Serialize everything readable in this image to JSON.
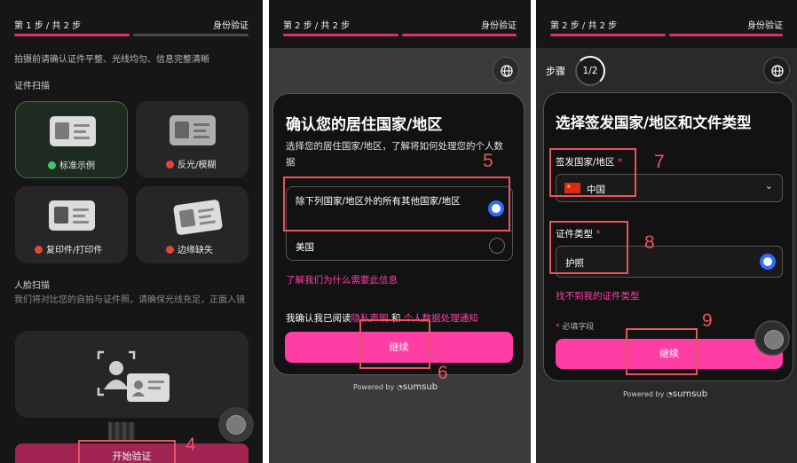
{
  "colors": {
    "accent": "#ff3ea5",
    "progress": "#e0306a",
    "annotation": "#e8545f",
    "radio": "#2f6dff",
    "ok": "#49c36a",
    "err": "#e8443c"
  },
  "panel1": {
    "step": "第 1 步 / 共 2 步",
    "title": "身份验证",
    "hint": "拍摄前请确认证件平整、光线均匀、信息完整清晰",
    "section_doc": "证件扫描",
    "examples": [
      {
        "label": "标准示例",
        "status": "ok"
      },
      {
        "label": "反光/模糊",
        "status": "error"
      },
      {
        "label": "复印件/打印件",
        "status": "error"
      },
      {
        "label": "边缘缺失",
        "status": "error"
      }
    ],
    "section_face": "人脸扫描",
    "face_hint": "我们将对比您的自拍与证件照，请确保光线充足，正面入镜",
    "start_button": "开始验证",
    "annotation": "4"
  },
  "panel2": {
    "step": "第 2 步 / 共 2 步",
    "title": "身份验证",
    "heading": "确认您的居住国家/地区",
    "desc": "选择您的居住国家/地区，了解将如何处理您的个人数据",
    "options": [
      {
        "label": "除下列国家/地区外的所有其他国家/地区",
        "selected": true
      },
      {
        "label": "美国",
        "selected": false
      }
    ],
    "learn_link": "了解我们为什么需要此信息",
    "consent_prefix": "我确认我已阅读",
    "privacy_link": "隐私声明",
    "consent_and": " 和 ",
    "data_link": "个人数据处理通知",
    "continue": "继续",
    "powered_by": "Powered by",
    "brand": "sumsub",
    "annot_options": "5",
    "annot_continue": "6"
  },
  "panel3": {
    "step": "第 2 步 / 共 2 步",
    "title": "身份验证",
    "step_label": "步骤",
    "step_count": "1/2",
    "heading": "选择签发国家/地区和文件类型",
    "country_label": "签发国家/地区",
    "country_value": "中国",
    "doc_label": "证件类型",
    "doc_value": "护照",
    "not_found": "找不到我的证件类型",
    "required_note": "必填字段",
    "continue": "继续",
    "powered_by": "Powered by",
    "brand": "sumsub",
    "annot_country": "7",
    "annot_doc": "8",
    "annot_continue": "9"
  }
}
